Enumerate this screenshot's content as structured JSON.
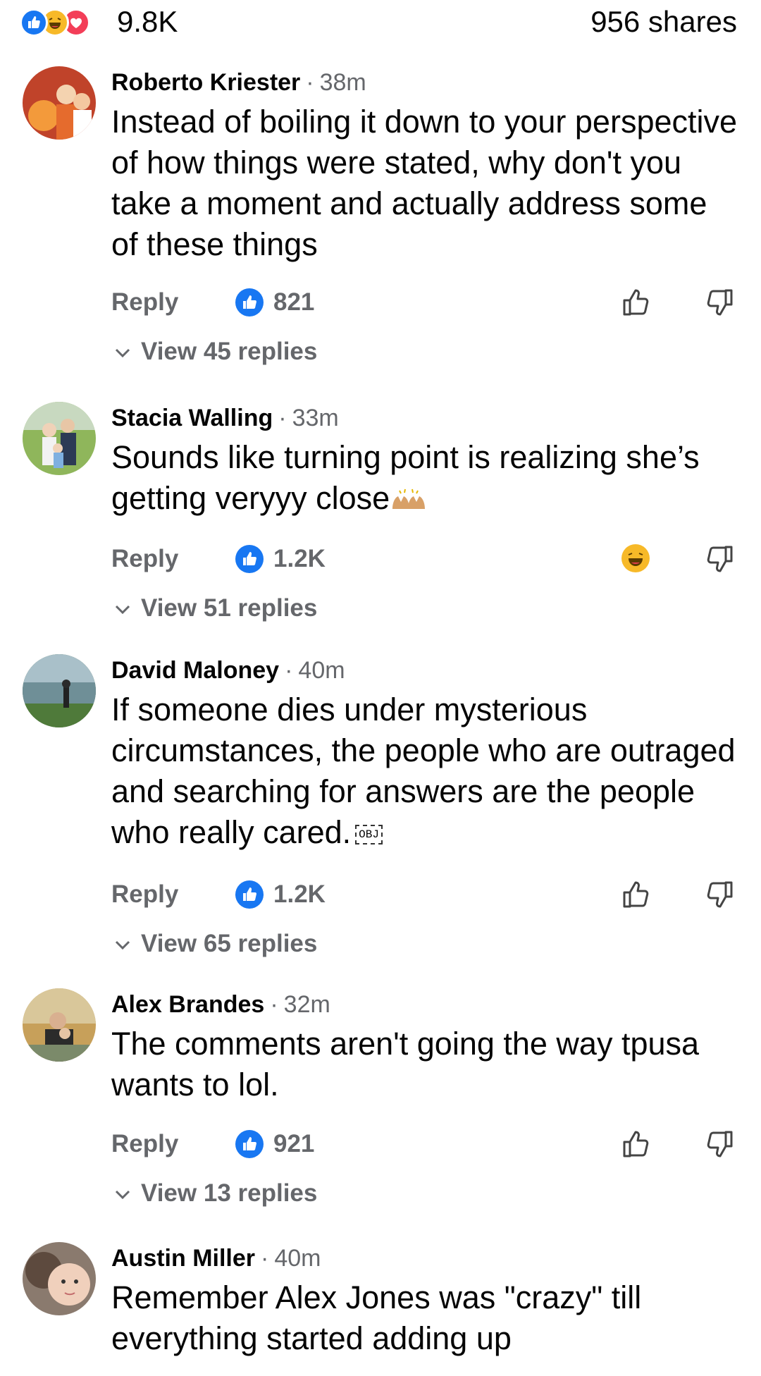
{
  "summary": {
    "reaction_icons": [
      "like-icon",
      "haha-icon",
      "love-icon"
    ],
    "reaction_count": "9.8K",
    "shares": "956 shares"
  },
  "labels": {
    "reply": "Reply",
    "separator": "·"
  },
  "comments": [
    {
      "author": "Roberto Kriester",
      "time": "38m",
      "text": "Instead of boiling it down to your perspective of how things were stated, why don't you take a moment and actually address some of these things",
      "likes": "821",
      "view_replies": "View 45 replies"
    },
    {
      "author": "Stacia Walling",
      "time": "33m",
      "text": "Sounds like turning point is realizing she’s getting veryyy close",
      "text_emoji": "raising-hands-emoji",
      "likes": "1.2K",
      "my_reaction": "haha-icon",
      "view_replies": "View 51 replies"
    },
    {
      "author": "David Maloney",
      "time": "40m",
      "text": "If someone dies under mysterious circumstances, the people who are outraged and searching for answers are the people who really cared.",
      "obj_glyph": "OBJ",
      "likes": "1.2K",
      "view_replies": "View 65 replies"
    },
    {
      "author": "Alex Brandes",
      "time": "32m",
      "text": "The comments aren't going the way tpusa wants to lol.",
      "likes": "921",
      "view_replies": "View 13 replies"
    },
    {
      "author": "Austin Miller",
      "time": "40m",
      "text": "Remember Alex Jones was \"crazy\" till everything started adding up"
    }
  ],
  "colors": {
    "like_blue": "#1877f2",
    "haha_yellow": "#f7b928",
    "love_red": "#f33e58",
    "secondary_text": "#65676b",
    "primary_text": "#050505"
  }
}
